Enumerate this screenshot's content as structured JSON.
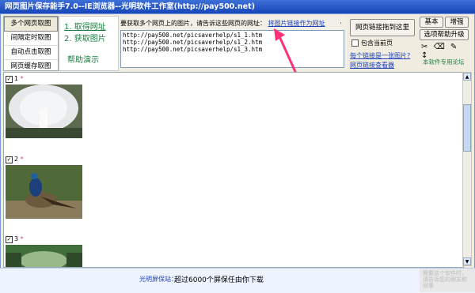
{
  "window": {
    "title": "网页图片保存能手7.0--IE浏览器--光明软件工作室(http://pay500.net)"
  },
  "tabs": [
    "多个网页取图",
    "间隔定时取图",
    "自动点击取图",
    "网页缓存取图"
  ],
  "steps": {
    "step1": "1. 取得网址",
    "step2": "2. 获取图片",
    "help": "帮助演示"
  },
  "url_section": {
    "prompt": "要获取多个网页上的图片，请告诉这些网页的网址：",
    "link": "将图片链接作为网址",
    "dot": "·",
    "urls": [
      "http://pay500.net/picsaverhelp/s1_1.htm",
      "http://pay500.net/picsaverhelp/s1_2.htm",
      "http://pay500.net/picsaverhelp/s1_3.htm"
    ]
  },
  "controls": {
    "drag_button": "网页链接拖到这里",
    "include_current": "包含当前页",
    "link_one_image": "每个链接是一张图片?",
    "link_viewer": "网页链接查看器"
  },
  "right_panel": {
    "basic": "基本",
    "enhance": "增强",
    "upgrade": "选项帮助升级",
    "tool_icons": [
      "scissors-icon",
      "eraser-icon",
      "brush-icon",
      "updown-icon"
    ],
    "forum": "本软件专用论坛"
  },
  "images": [
    {
      "num": "1",
      "star": "*",
      "colors": [
        "#5d6a4e",
        "#e6e8ea",
        "#3a4a32"
      ]
    },
    {
      "num": "2",
      "star": "*",
      "colors": [
        "#4f6a38",
        "#1d3f7a",
        "#8a7b5a"
      ]
    },
    {
      "num": "3",
      "star": "*",
      "colors": [
        "#3f6e3a",
        "#9ab98a",
        "#2f4a2a"
      ]
    }
  ],
  "status": {
    "label": "光明屏保站：",
    "text": "超过6000个屏保任由你下载"
  },
  "corner_text": "需要这个软件时，请告诉您的朋友和同事",
  "colors": {
    "title_bar": "#1746b8",
    "link": "#1c3fbe",
    "green": "#1a7f40",
    "arrow": "#ff2f7a"
  }
}
